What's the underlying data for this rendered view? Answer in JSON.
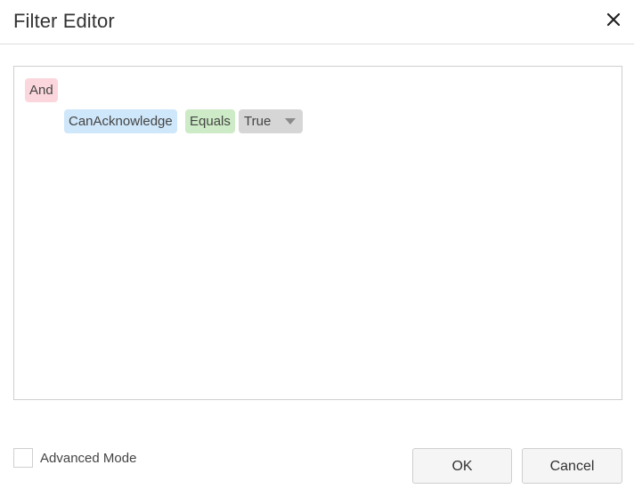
{
  "dialog": {
    "title": "Filter Editor",
    "close_icon": "close-icon"
  },
  "filter": {
    "group_operator": "And",
    "condition": {
      "field": "CanAcknowledge",
      "operation": "Equals",
      "value": "True"
    }
  },
  "footer": {
    "advanced_mode_label": "Advanced Mode",
    "advanced_mode_checked": false,
    "ok_label": "OK",
    "cancel_label": "Cancel"
  },
  "colors": {
    "group_chip": "#fbd7dd",
    "field_chip": "#cfe7fa",
    "operation_chip": "#cdebc6",
    "value_editor": "#d6d6d6"
  }
}
